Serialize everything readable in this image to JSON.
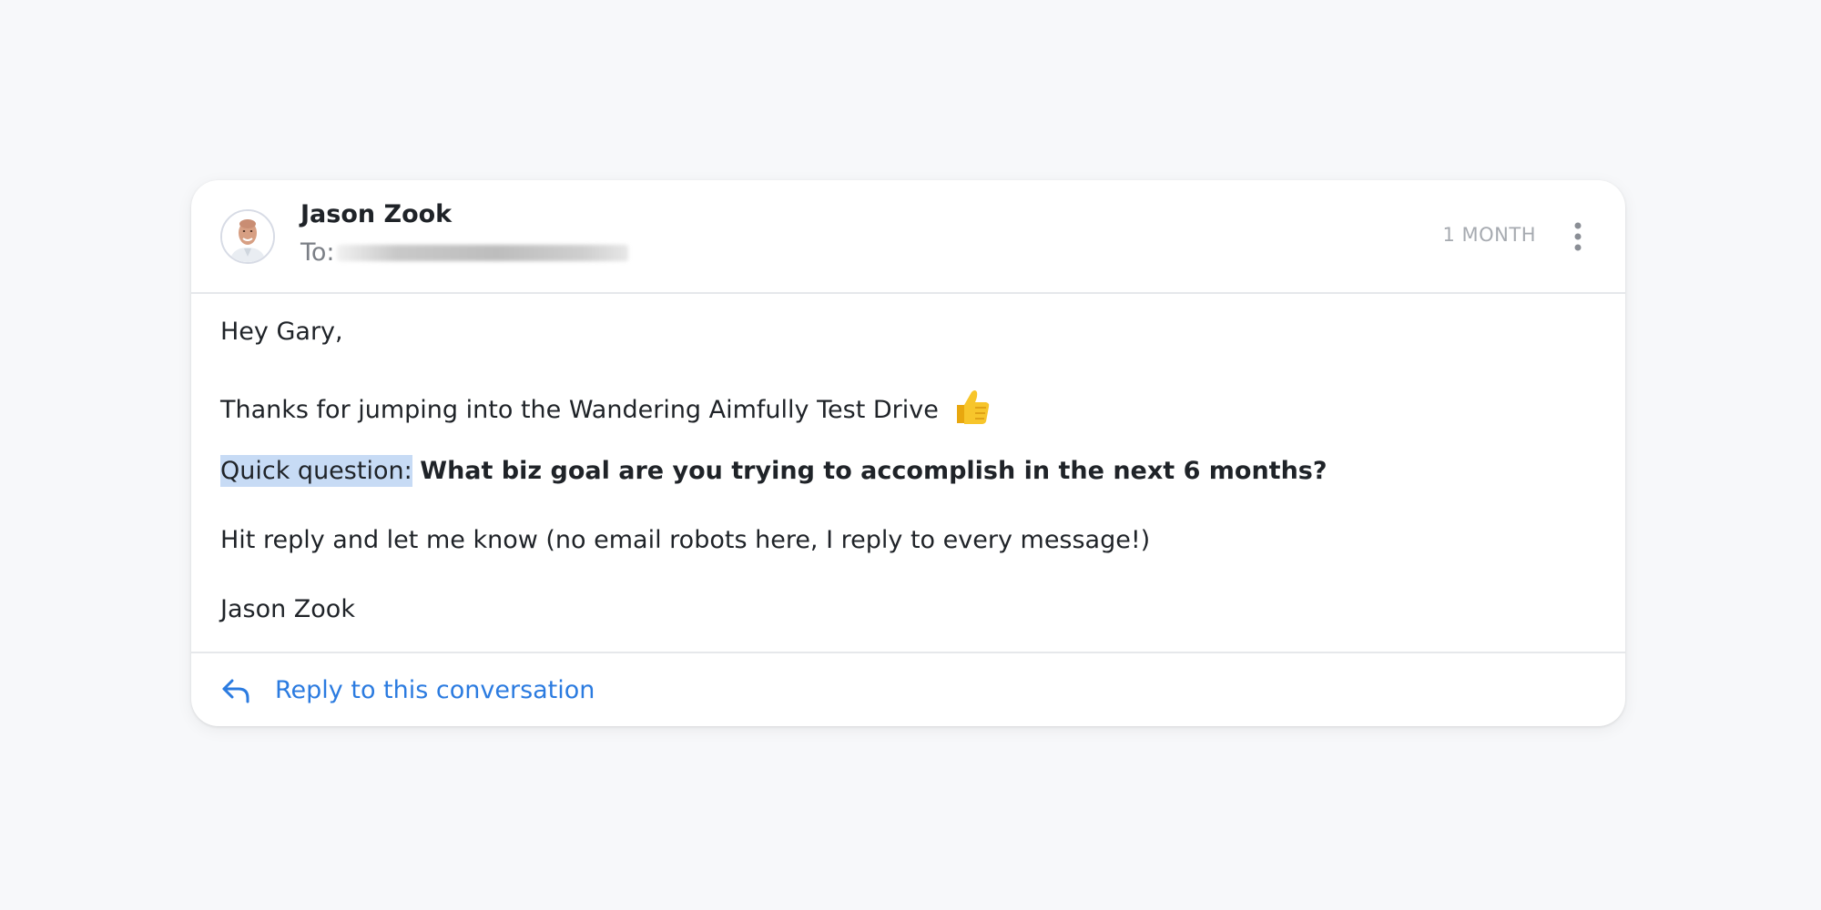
{
  "message": {
    "sender_name": "Jason Zook",
    "to_label": "To:",
    "timestamp": "1 MONTH",
    "body": {
      "greeting": "Hey Gary,",
      "line2": "Thanks for jumping into the Wandering Aimfully Test Drive",
      "line3_highlight": "Quick question:",
      "line3_bold": "What biz goal are you trying to accomplish in the next 6 months?",
      "line4": "Hit reply and let me know (no email robots here, I reply to every message!)",
      "signature": "Jason Zook"
    }
  },
  "footer": {
    "reply_label": "Reply to this conversation"
  },
  "icons": {
    "more": "more-vertical-icon",
    "reply": "reply-arrow-icon",
    "emoji": "thumbs-up-icon",
    "avatar": "avatar-photo"
  },
  "colors": {
    "accent": "#2b7be0",
    "highlight": "#c7dbf5",
    "muted": "#a6aab0"
  }
}
